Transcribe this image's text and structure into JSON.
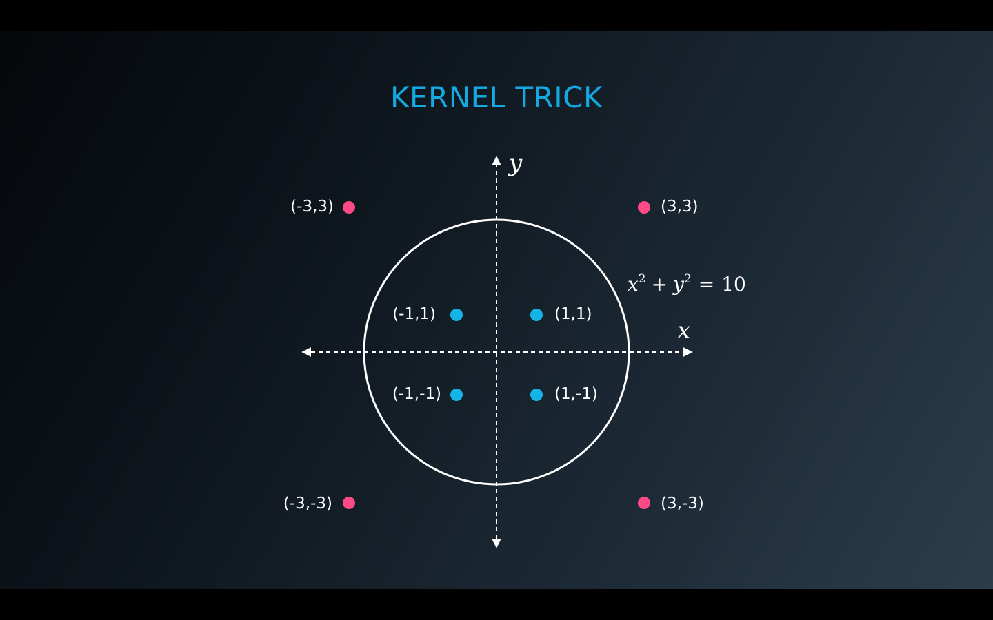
{
  "slide": {
    "title": "KERNEL TRICK",
    "colors": {
      "title": "#14a9e1",
      "inner_points": "#14b4e6",
      "outer_points": "#ff4a86",
      "lines": "#ffffff"
    }
  },
  "axes": {
    "x_label": "x",
    "y_label": "y",
    "style": "dashed with arrowheads"
  },
  "circle": {
    "equation_lhs_x": "x",
    "equation_exp_x": "2",
    "equation_plus": "+",
    "equation_lhs_y": "y",
    "equation_exp_y": "2",
    "equation_equals": "=",
    "equation_rhs": "10",
    "radius_squared": 10
  },
  "points": {
    "inner": [
      {
        "label": "(-1,1)",
        "x": -1,
        "y": 1
      },
      {
        "label": "(1,1)",
        "x": 1,
        "y": 1
      },
      {
        "label": "(-1,-1)",
        "x": -1,
        "y": -1
      },
      {
        "label": "(1,-1)",
        "x": 1,
        "y": -1
      }
    ],
    "outer": [
      {
        "label": "(-3,3)",
        "x": -3,
        "y": 3
      },
      {
        "label": "(3,3)",
        "x": 3,
        "y": 3
      },
      {
        "label": "(-3,-3)",
        "x": -3,
        "y": -3
      },
      {
        "label": "(3,-3)",
        "x": 3,
        "y": -3
      }
    ]
  }
}
